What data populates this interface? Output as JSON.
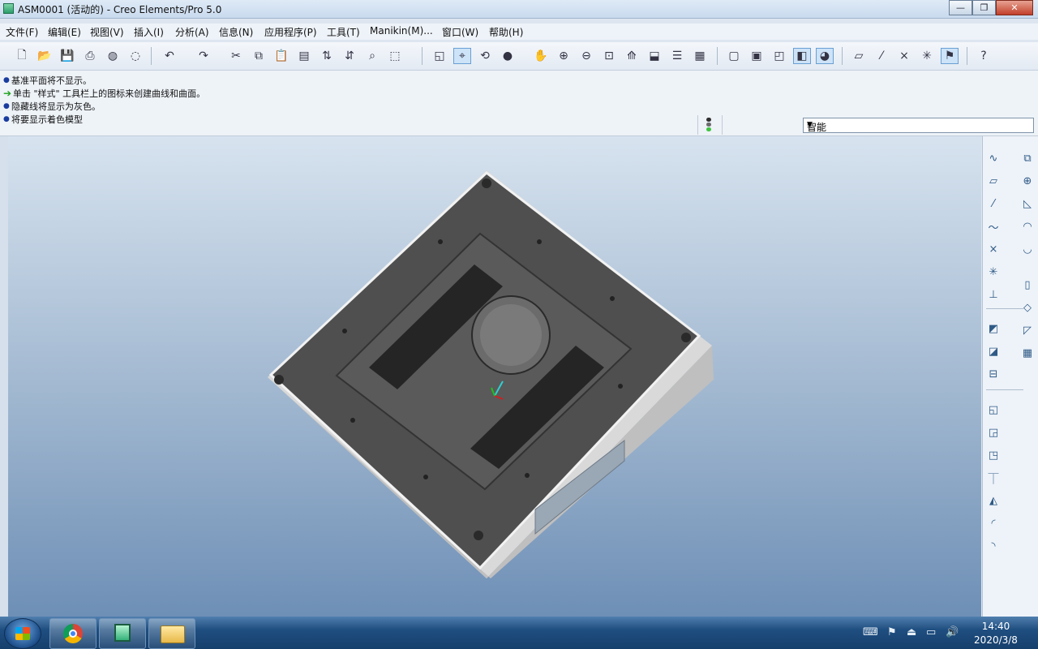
{
  "window": {
    "title": "ASM0001 (活动的) - Creo Elements/Pro 5.0",
    "buttons": [
      "—",
      "❐",
      "✕"
    ]
  },
  "menu": {
    "items": [
      "文件(F)",
      "编辑(E)",
      "视图(V)",
      "插入(I)",
      "分析(A)",
      "信息(N)",
      "应用程序(P)",
      "工具(T)",
      "Manikin(M)...",
      "窗口(W)",
      "帮助(H)"
    ]
  },
  "toolbar": {
    "icons": [
      "new-file-icon",
      "open-icon",
      "save-icon",
      "print-icon",
      "print-preview-icon",
      "email-icon",
      "undo-icon",
      "redo-icon",
      "cut-icon",
      "copy-icon",
      "paste-icon",
      "paste-special-icon",
      "regenerate-icon",
      "regenerate-manager-icon",
      "find-icon",
      "select-box-icon",
      "repaint-icon",
      "spin-center-icon",
      "orient-mode-icon",
      "appearance-icon",
      "pan-icon",
      "zoom-in-icon",
      "zoom-out-icon",
      "refit-icon",
      "reorient-icon",
      "saved-views-icon",
      "layers-icon",
      "view-manager-icon",
      "wireframe-icon",
      "hidden-line-icon",
      "no-hidden-icon",
      "shading-icon",
      "enhanced-realism-icon",
      "datum-planes-icon",
      "datum-axes-icon",
      "datum-points-icon",
      "coordinate-systems-icon",
      "annotations-icon",
      "context-help-icon"
    ]
  },
  "messages": [
    {
      "icon": "bullet",
      "text": "基准平面将不显示。"
    },
    {
      "icon": "arrow",
      "text": "单击 \"样式\" 工具栏上的图标来创建曲线和曲面。"
    },
    {
      "icon": "bullet",
      "text": "隐藏线将显示为灰色。"
    },
    {
      "icon": "bullet",
      "text": "将要显示着色模型"
    }
  ],
  "filter": {
    "value": "智能"
  },
  "colors": {
    "titlebar": "#c9daee",
    "background_top": "#d7e3ef",
    "background_bottom": "#6e8fb6",
    "model_dark": "#4a4a4a",
    "model_light": "#e8e8e8",
    "taskbar": "#1f4e80"
  },
  "rightbar": {
    "icons": [
      "sketch-icon",
      "plane-icon",
      "axis-icon",
      "curve-icon",
      "point-icon",
      "point-offset-icon",
      "coordinate-system-icon",
      "analysis-icon",
      "assemble-icon",
      "create-component-icon",
      "mirror-icon",
      "sheet-metal-icon",
      "skeleton-icon",
      "pattern-icon",
      "merge-icon",
      "restructure-icon",
      "copy-geometry-icon",
      "component-interface-icon",
      "flexible-icon",
      "cut-out-icon",
      "round-icon",
      "draft-icon",
      "sweep-icon"
    ]
  },
  "taskbar": {
    "apps": [
      "windows-start-icon",
      "chrome-icon",
      "creo-icon",
      "explorer-icon"
    ],
    "time": "14:40",
    "date": "2020/3/8"
  }
}
